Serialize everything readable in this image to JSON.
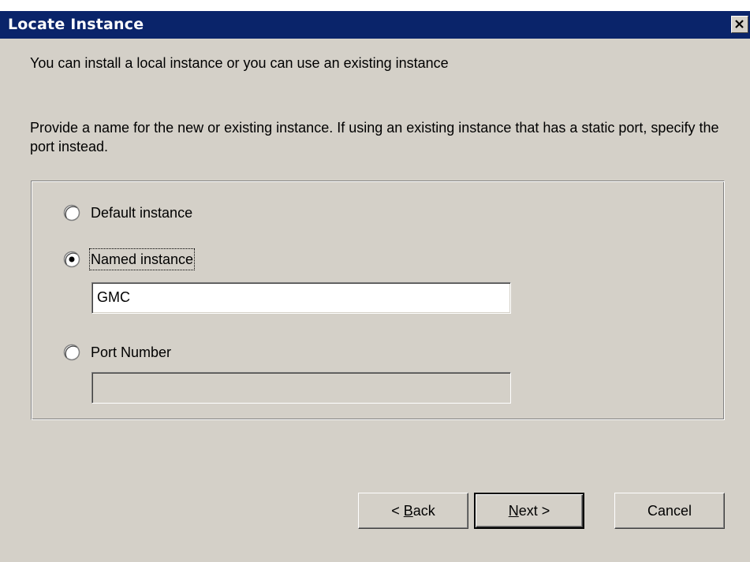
{
  "window": {
    "title": "Locate Instance"
  },
  "content": {
    "intro": "You can install a local instance or you can use an existing instance",
    "prompt": "Provide a name for the new or existing instance.  If using an existing instance that has a static port, specify the port instead."
  },
  "options": {
    "default_instance": {
      "label": "Default instance",
      "selected": false
    },
    "named_instance": {
      "label": "Named instance",
      "selected": true,
      "value": "GMC"
    },
    "port_number": {
      "label": "Port Number",
      "selected": false,
      "value": ""
    }
  },
  "buttons": {
    "back": {
      "prefix": "< ",
      "mnemonic": "B",
      "rest": "ack"
    },
    "next": {
      "mnemonic": "N",
      "rest": "ext >"
    },
    "cancel": "Cancel"
  },
  "colors": {
    "titlebar": "#0a246a",
    "dialog_bg": "#d4d0c8"
  }
}
